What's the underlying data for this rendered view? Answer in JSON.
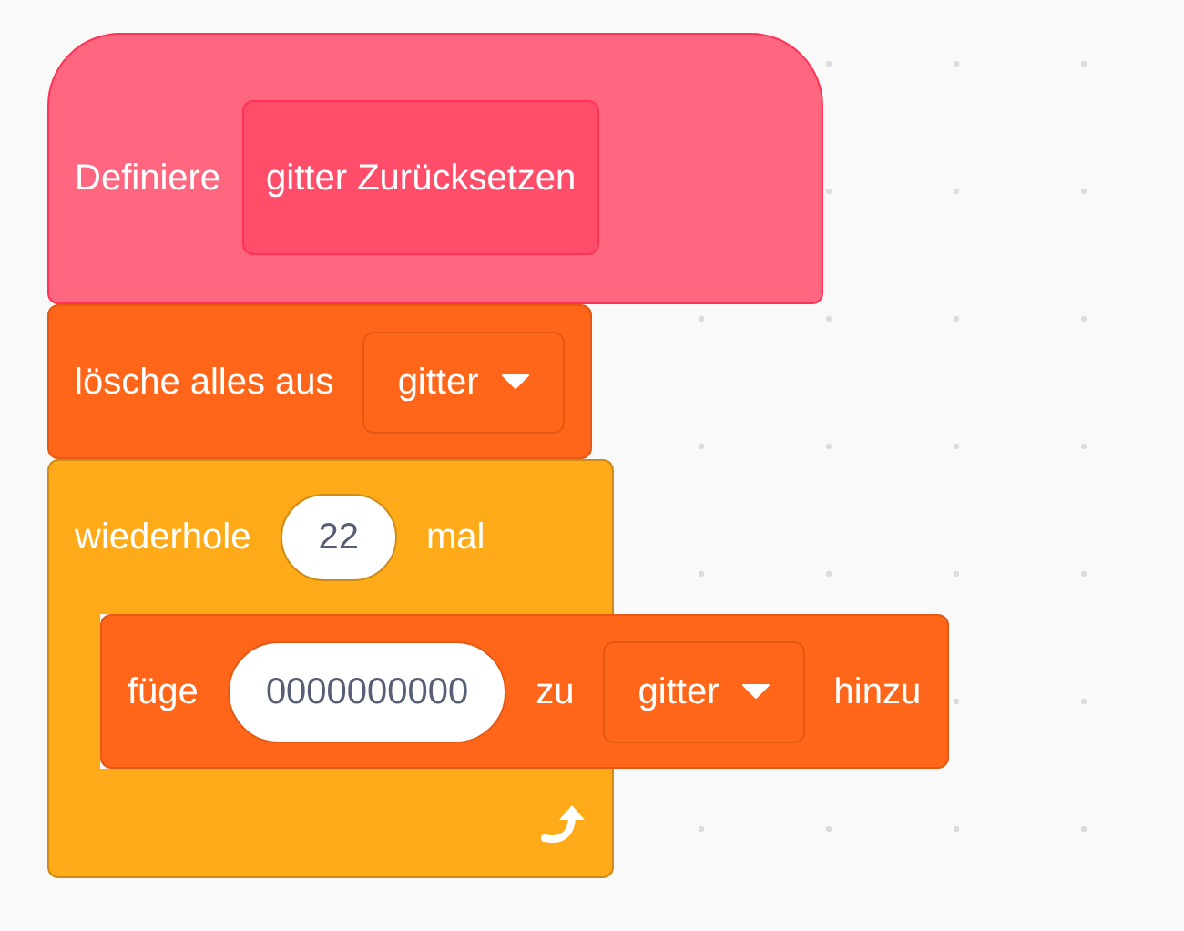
{
  "script": [
    {
      "kind": "define",
      "parts": [
        {
          "kind": "label",
          "text": "Definiere"
        },
        {
          "kind": "custom",
          "text": "gitter Zurücksetzen"
        }
      ]
    },
    {
      "kind": "command",
      "parts": [
        {
          "kind": "label",
          "text": "lösche alles aus"
        },
        {
          "kind": "dropdown",
          "text": "gitter"
        }
      ]
    },
    {
      "kind": "repeat",
      "parts": [
        {
          "kind": "label",
          "text": "wiederhole"
        },
        {
          "kind": "number",
          "text": "22"
        },
        {
          "kind": "label",
          "text": "mal"
        }
      ],
      "children": [
        {
          "kind": "command",
          "parts": [
            {
              "kind": "label",
              "text": "füge"
            },
            {
              "kind": "text",
              "text": "0000000000"
            },
            {
              "kind": "label",
              "text": "zu"
            },
            {
              "kind": "dropdown",
              "text": "gitter"
            },
            {
              "kind": "label",
              "text": "hinzu"
            }
          ]
        }
      ]
    }
  ]
}
